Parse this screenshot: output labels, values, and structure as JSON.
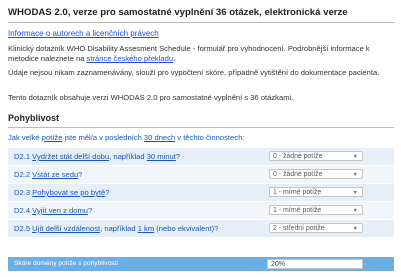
{
  "header": {
    "title": "WHODAS 2.0, verze pro samostatné vyplnění 36 otázek, elektronická verze",
    "authors_link": "Informace o autorech a licenčních právech"
  },
  "intro": {
    "p1_text": "Klinický dotazník WHO Disability Assesment Schedule - formulář pro vyhodnocení. Podrobnější informace k metodice naleznete na ",
    "p1_link": "stránce českého překladu",
    "p1_end": ".",
    "p2_text": "Údaje nejsou nikam zaznamenávány, slouží pro vypočtení skóre, případně vytištění do dokumentace pacienta.",
    "p3_text": "Tento dotazník obsahuje verzi WHODAS 2.0 pro samostatné vyplnění s 36 otázkami."
  },
  "section": {
    "title": "Pohyblivost",
    "question_parts": [
      "Jak velké ",
      "potíže",
      " jste měl/a v posledních ",
      "30 dnech",
      " v těchto činnostech:"
    ]
  },
  "items": [
    {
      "parts": [
        "D2.1 ",
        "Vydržet stát delší dobu",
        ", například ",
        "30 minut",
        "?"
      ],
      "value": "0 - žádné potíže"
    },
    {
      "parts": [
        "D2.2 ",
        "Vstát ze sedu",
        "?",
        "",
        ""
      ],
      "value": "0 - žádné potíže"
    },
    {
      "parts": [
        "D2.3 ",
        "Pohybovat se po bytě",
        "?",
        "",
        ""
      ],
      "value": "1 - mírné potíže"
    },
    {
      "parts": [
        "D2.4 ",
        "Vyjít ven z domu",
        "?",
        "",
        ""
      ],
      "value": "1 - mírné potíže"
    },
    {
      "parts": [
        "D2.5 ",
        "Ujít delší vzdálenost",
        ", například ",
        "1 km",
        " (nebo ekvivalent)?"
      ],
      "value": "2 - střední potíže"
    }
  ],
  "score": {
    "label": "Skóre domény potíže s pohyblivostí",
    "value": "20%"
  },
  "icons": {
    "dropdown_arrow": "chevron-down-icon"
  }
}
